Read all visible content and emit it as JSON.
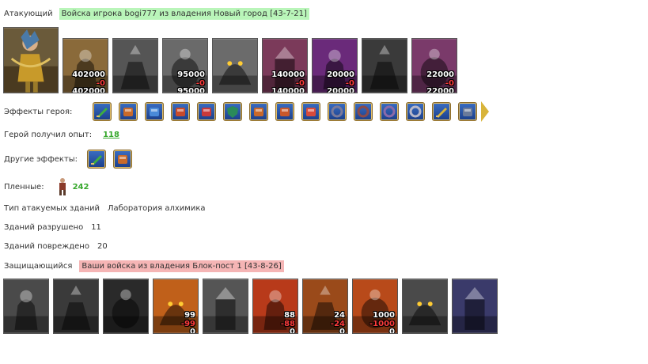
{
  "attacker": {
    "label": "Атакующий",
    "title": "Войска игрока bogi777 из владения Новый город [43-7-21]"
  },
  "attacker_units": [
    {
      "name": "unit-1",
      "count": "402000",
      "loss": "-0",
      "remain": "402000",
      "color": "#8a6a3a"
    },
    {
      "name": "unit-2",
      "count": "",
      "loss": "",
      "remain": "",
      "color": "#555555"
    },
    {
      "name": "unit-3",
      "count": "95000",
      "loss": "-0",
      "remain": "95000",
      "color": "#6a6a6a"
    },
    {
      "name": "unit-4",
      "count": "",
      "loss": "",
      "remain": "",
      "color": "#6b6b6b"
    },
    {
      "name": "unit-5",
      "count": "140000",
      "loss": "-0",
      "remain": "140000",
      "color": "#7b3a5a"
    },
    {
      "name": "unit-6",
      "count": "20000",
      "loss": "-0",
      "remain": "20000",
      "color": "#6a2a7a"
    },
    {
      "name": "unit-7",
      "count": "",
      "loss": "",
      "remain": "",
      "color": "#3a3a3a"
    },
    {
      "name": "unit-8",
      "count": "22000",
      "loss": "-0",
      "remain": "22000",
      "color": "#7a3a6a"
    }
  ],
  "hero_effects": {
    "label": "Эффекты героя:",
    "icons": [
      "sword-icon",
      "handshake-icon",
      "hand-book-icon",
      "chest-icon",
      "dice-icon",
      "shield-icon",
      "treasure-icon",
      "hand-gift-icon",
      "feather-icon",
      "gear-ring-icon",
      "skull-ring-icon",
      "spiral-ring-icon",
      "chain-icon",
      "staff-icon",
      "gate-icon"
    ]
  },
  "experience": {
    "label": "Герой получил опыт:",
    "value": "118"
  },
  "other_effects": {
    "label": "Другие эффекты:",
    "icons": [
      "sword-icon",
      "heart-banner-icon"
    ]
  },
  "prisoners": {
    "label": "Пленные:",
    "value": "242"
  },
  "buildings": {
    "type_label": "Тип атакуемых зданий",
    "type_value": "Лаборатория алхимика",
    "destroyed_label": "Зданий разрушено",
    "destroyed_value": "11",
    "damaged_label": "Зданий повреждено",
    "damaged_value": "20"
  },
  "defender": {
    "label": "Защищающийся",
    "title": "Ваши войска из владения Блок-пост 1 [43-8-26]"
  },
  "defender_units": [
    {
      "name": "def-unit-1",
      "count": "",
      "loss": "",
      "remain": "",
      "color": "#4a4a4a"
    },
    {
      "name": "def-unit-2",
      "count": "",
      "loss": "",
      "remain": "",
      "color": "#3a3a3a"
    },
    {
      "name": "def-unit-3",
      "count": "",
      "loss": "",
      "remain": "",
      "color": "#2a2a2a"
    },
    {
      "name": "def-unit-4",
      "count": "99",
      "loss": "-99",
      "remain": "0",
      "color": "#c0601a"
    },
    {
      "name": "def-unit-5",
      "count": "",
      "loss": "",
      "remain": "",
      "color": "#555555"
    },
    {
      "name": "def-unit-6",
      "count": "88",
      "loss": "-88",
      "remain": "0",
      "color": "#b83a1a"
    },
    {
      "name": "def-unit-7",
      "count": "24",
      "loss": "-24",
      "remain": "0",
      "color": "#9a4a1a"
    },
    {
      "name": "def-unit-8",
      "count": "1000",
      "loss": "-1000",
      "remain": "0",
      "color": "#b84a1a"
    },
    {
      "name": "def-unit-9",
      "count": "",
      "loss": "",
      "remain": "",
      "color": "#4a4a4a"
    },
    {
      "name": "def-unit-10",
      "count": "",
      "loss": "",
      "remain": "",
      "color": "#3a3a6a"
    }
  ]
}
